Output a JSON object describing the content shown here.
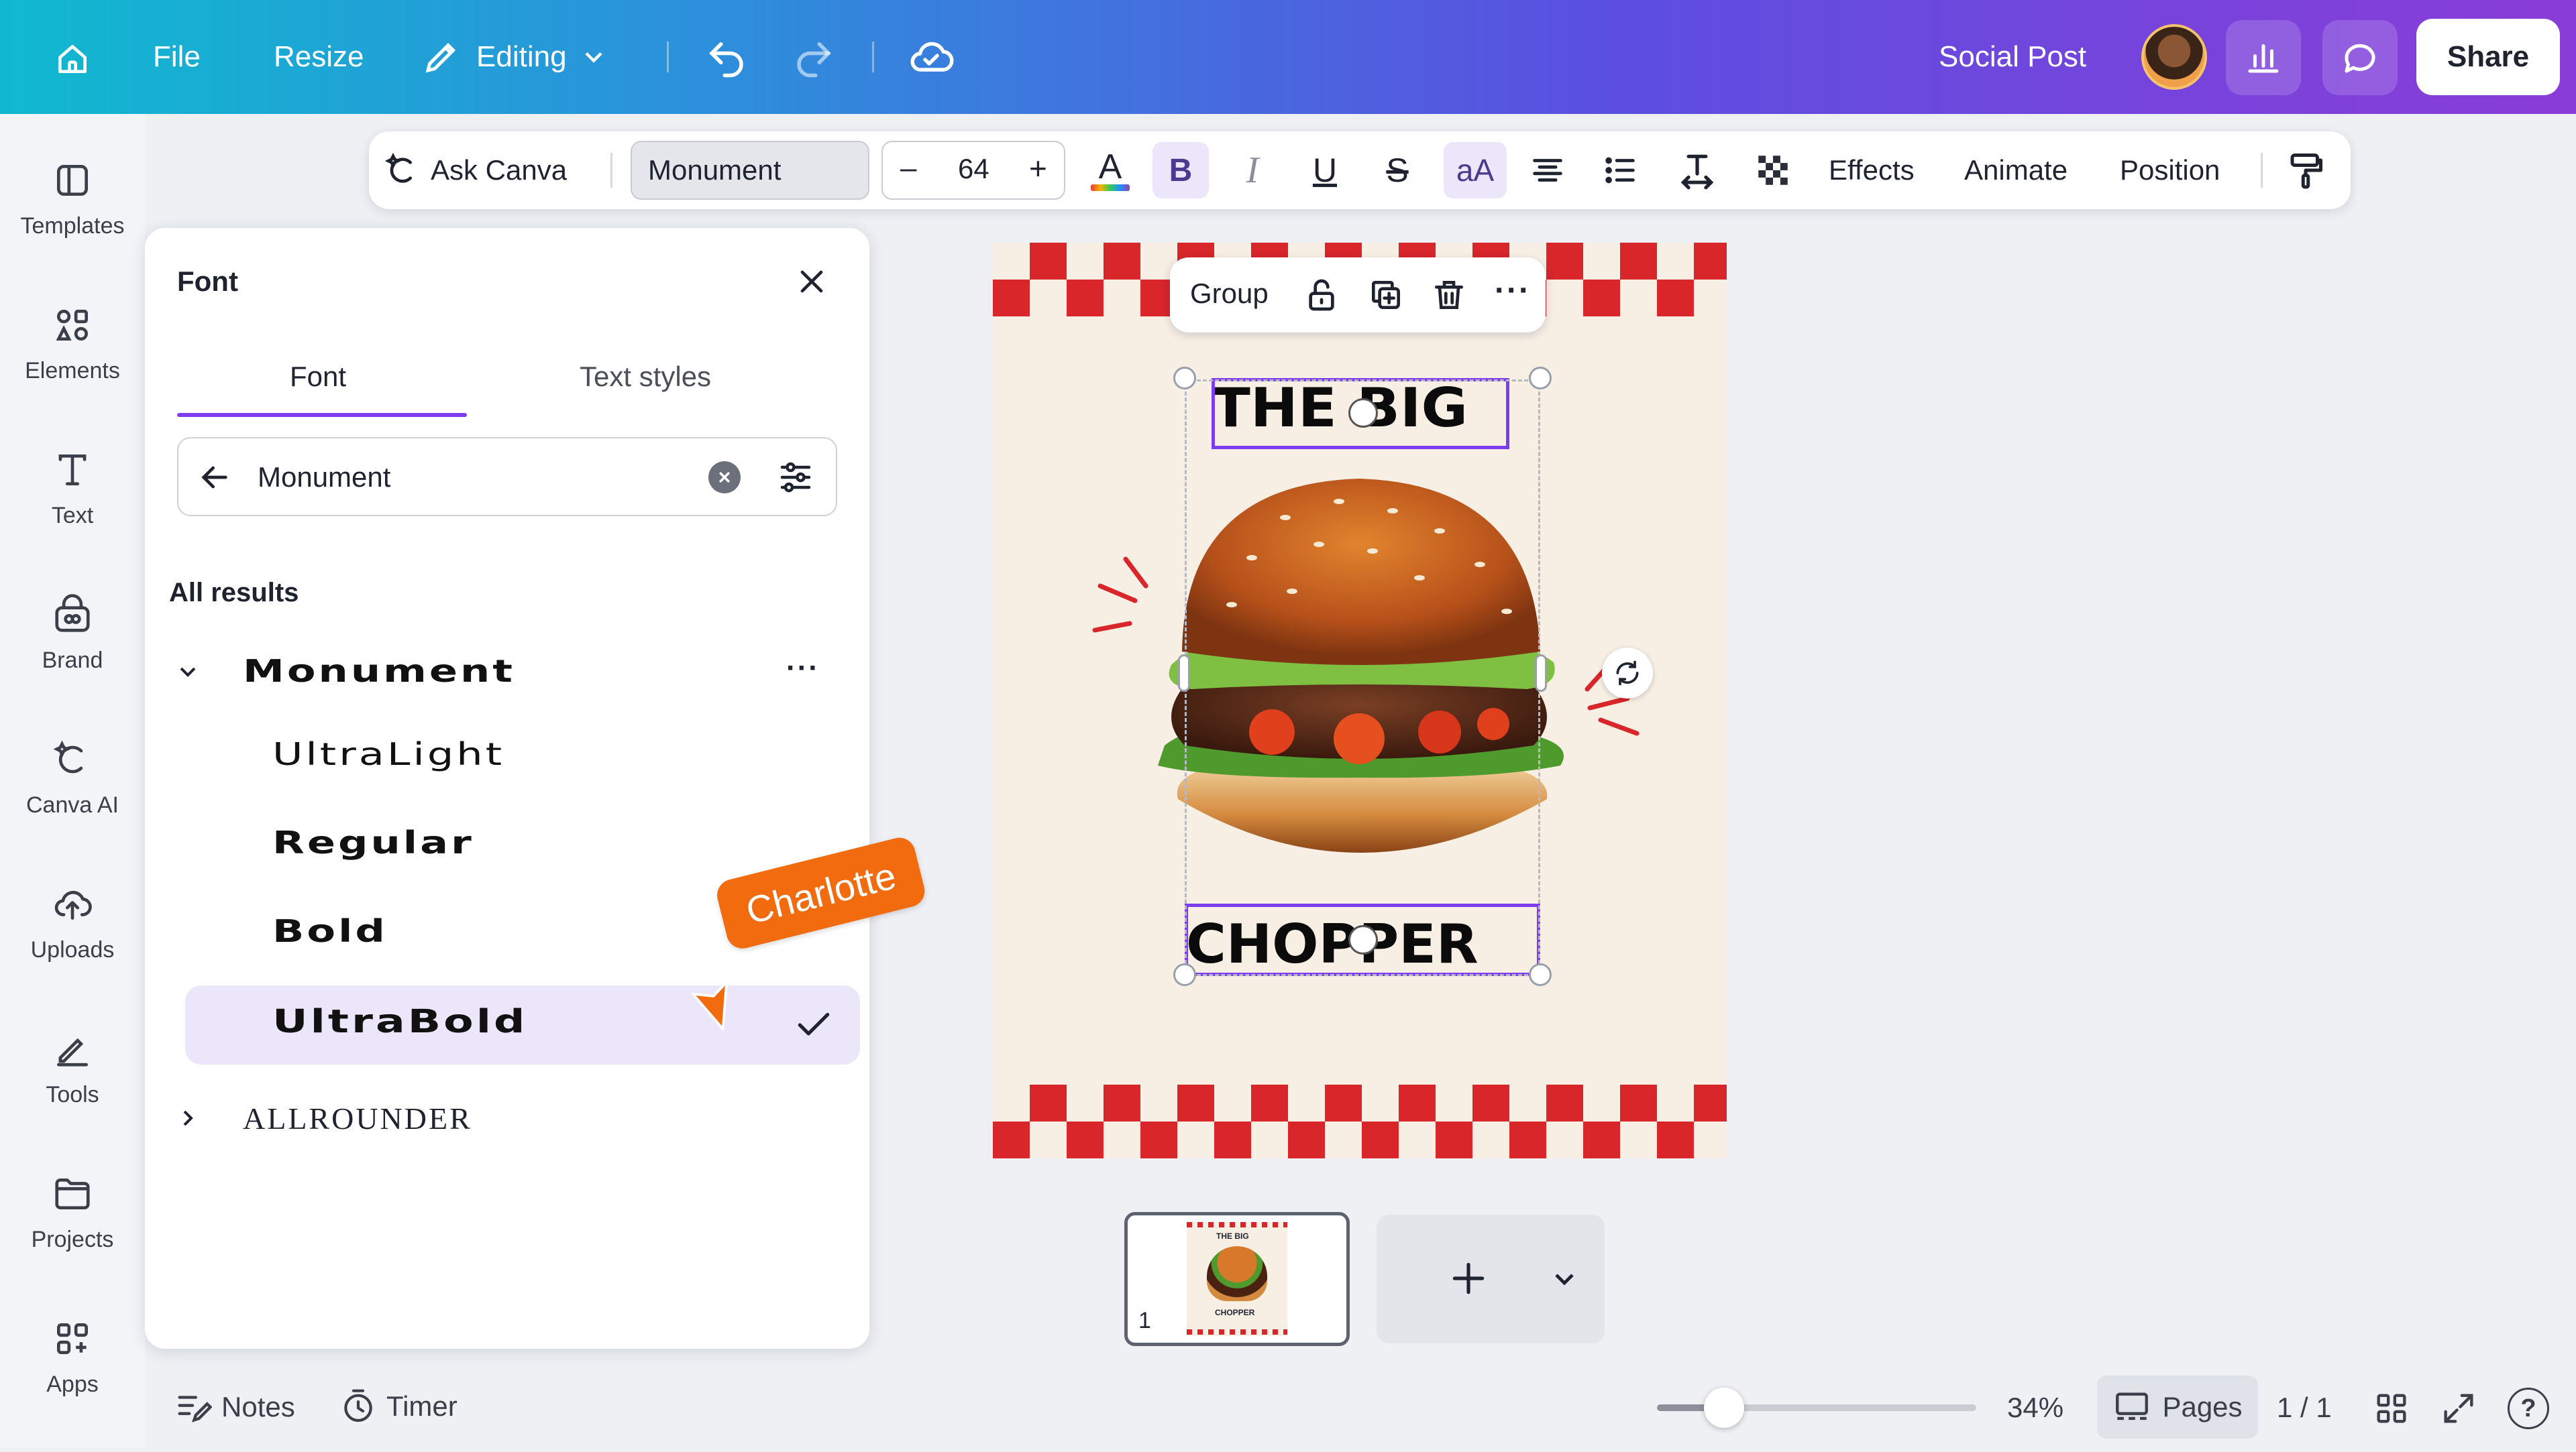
{
  "topbar": {
    "file": "File",
    "resize": "Resize",
    "editing": "Editing",
    "doc_title": "Social Post",
    "share": "Share"
  },
  "rail": {
    "items": [
      {
        "label": "Templates",
        "icon": "templates-icon"
      },
      {
        "label": "Elements",
        "icon": "elements-icon"
      },
      {
        "label": "Text",
        "icon": "text-icon"
      },
      {
        "label": "Brand",
        "icon": "brand-icon"
      },
      {
        "label": "Canva AI",
        "icon": "canva-ai-icon"
      },
      {
        "label": "Uploads",
        "icon": "uploads-icon"
      },
      {
        "label": "Tools",
        "icon": "tools-icon"
      },
      {
        "label": "Projects",
        "icon": "projects-icon"
      },
      {
        "label": "Apps",
        "icon": "apps-icon"
      }
    ]
  },
  "toolbar": {
    "ask_canva": "Ask Canva",
    "font_name": "Monument",
    "font_size": "64",
    "minus": "–",
    "plus": "+",
    "bold": "B",
    "italic": "I",
    "underline": "U",
    "strike": "S",
    "case": "aA",
    "effects": "Effects",
    "animate": "Animate",
    "position": "Position"
  },
  "panel": {
    "title": "Font",
    "tabs": [
      "Font",
      "Text styles"
    ],
    "search_value": "Monument",
    "results_label": "All results",
    "family": "Monument",
    "weights": [
      "UltraLight",
      "Regular",
      "Bold",
      "UltraBold"
    ],
    "selected_weight": "UltraBold",
    "other_family": "ALLROUNDER"
  },
  "cursor_label": "Charlotte",
  "canvas": {
    "group_label": "Group",
    "headline_top": "THE BIG",
    "headline_bottom": "CHOPPER"
  },
  "pages": {
    "thumb_number": "1",
    "thumb_top": "THE BIG",
    "thumb_bottom": "CHOPPER"
  },
  "bottombar": {
    "notes": "Notes",
    "timer": "Timer",
    "zoom": "34%",
    "zoom_level": 0.34,
    "pages": "Pages",
    "page_count": "1 / 1"
  },
  "colors": {
    "accent": "#7d3cf0",
    "selected_row": "#ece6fb",
    "checker_red": "#d8262b",
    "cursor_orange": "#f26b0f",
    "canvas_bg": "#f8efe4"
  }
}
